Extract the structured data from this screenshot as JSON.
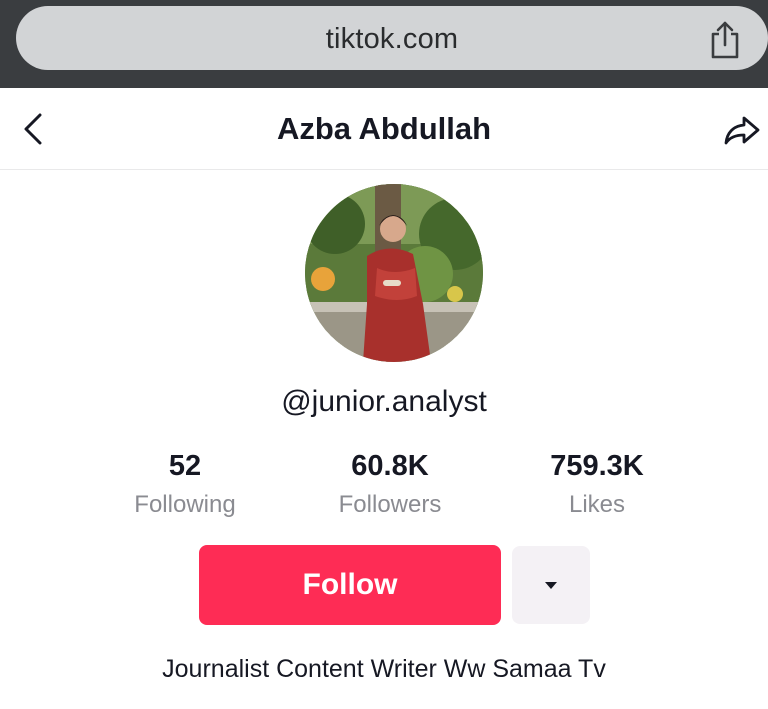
{
  "browser": {
    "url": "tiktok.com",
    "share_icon": "share-icon"
  },
  "header": {
    "back_icon": "chevron-left-icon",
    "title": "Azba Abdullah",
    "forward_icon": "share-arrow-icon"
  },
  "profile": {
    "username": "@junior.analyst",
    "bio": "Journalist Content Writer Ww Samaa Tv"
  },
  "stats": [
    {
      "value": "52",
      "label": "Following"
    },
    {
      "value": "60.8K",
      "label": "Followers"
    },
    {
      "value": "759.3K",
      "label": "Likes"
    }
  ],
  "actions": {
    "follow_label": "Follow",
    "more_icon": "caret-down-icon"
  },
  "colors": {
    "accent": "#fe2c55",
    "browser_bar": "#3a3d40",
    "url_pill": "#d2d4d6",
    "muted_text": "#8a8b91",
    "secondary_button": "#f4f1f5"
  }
}
